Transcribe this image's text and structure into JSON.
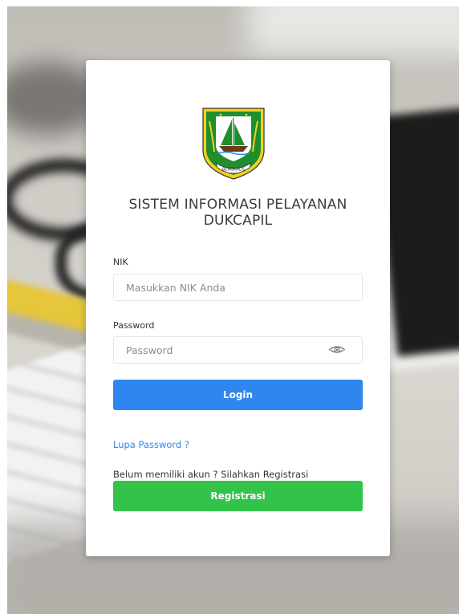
{
  "login": {
    "title": "SISTEM INFORMASI PELAYANAN DUKCAPIL",
    "logo": {
      "icon": "regional-emblem-icon",
      "emblem_text": "BENGKALIS"
    },
    "nik": {
      "label": "NIK",
      "placeholder": "Masukkan NIK Anda",
      "value": ""
    },
    "password": {
      "label": "Password",
      "placeholder": "Password",
      "value": "",
      "toggle_icon": "eye-icon"
    },
    "login_button": "Login",
    "forgot_password": "Lupa Password ?",
    "register_hint": "Belum memiliki akun ? Silahkan Registrasi",
    "register_button": "Registrasi"
  },
  "colors": {
    "primary": "#2f86ee",
    "success": "#33c24a",
    "emblem_green": "#1f8f2e",
    "emblem_yellow": "#f1d21c"
  }
}
